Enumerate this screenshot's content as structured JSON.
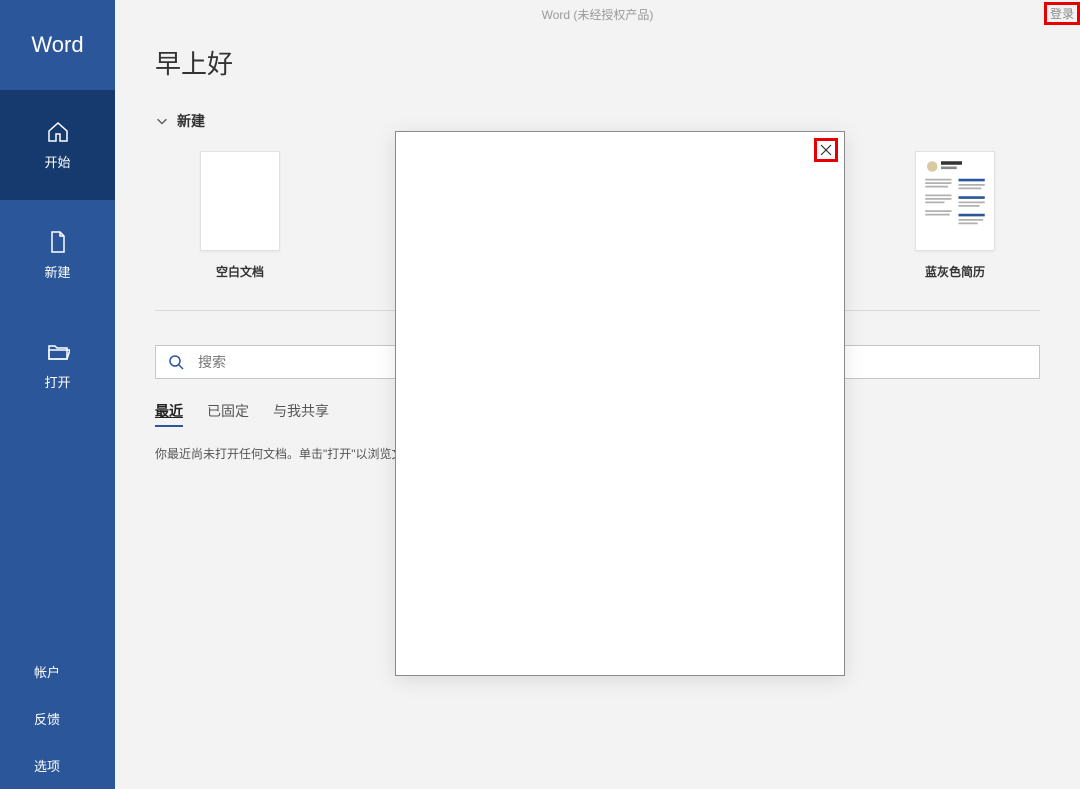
{
  "window": {
    "title": "Word (未经授权产品)"
  },
  "signin": {
    "label": "登录"
  },
  "brand": "Word",
  "sidebar": {
    "items": [
      {
        "label": "开始",
        "icon": "home-icon"
      },
      {
        "label": "新建",
        "icon": "new-file-icon"
      },
      {
        "label": "打开",
        "icon": "open-folder-icon"
      }
    ],
    "footer": [
      {
        "label": "帐户"
      },
      {
        "label": "反馈"
      },
      {
        "label": "选项"
      }
    ]
  },
  "greeting": "早上好",
  "new_section": {
    "label": "新建"
  },
  "templates": [
    {
      "label": "空白文档"
    },
    {
      "label": "蓝灰色简历"
    }
  ],
  "search": {
    "placeholder": "搜索"
  },
  "tabs": [
    {
      "label": "最近"
    },
    {
      "label": "已固定"
    },
    {
      "label": "与我共享"
    }
  ],
  "recent_empty": "你最近尚未打开任何文档。单击\"打开\"以浏览文"
}
